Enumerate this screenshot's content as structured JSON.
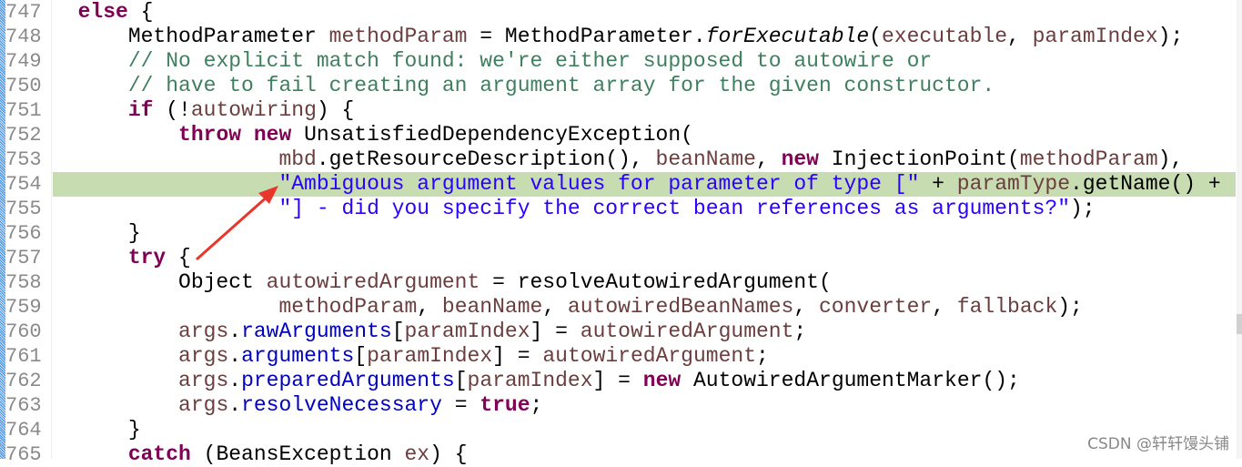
{
  "colors": {
    "keyword": "#7f0055",
    "comment": "#3f7f5f",
    "field": "#0000c0",
    "string": "#2a00ff",
    "local": "#6a3e3e",
    "highlight": "#c7ddb1",
    "arrow": "#e8362c"
  },
  "highlighted_line": "754",
  "lines": [
    {
      "n": "747",
      "t": [
        [
          "p",
          "  "
        ],
        [
          "kw",
          "else"
        ],
        [
          "p",
          " {"
        ]
      ]
    },
    {
      "n": "748",
      "t": [
        [
          "p",
          "      MethodParameter "
        ],
        [
          "lv",
          "methodParam"
        ],
        [
          "p",
          " = MethodParameter."
        ],
        [
          "it",
          "forExecutable"
        ],
        [
          "p",
          "("
        ],
        [
          "lv",
          "executable"
        ],
        [
          "p",
          ", "
        ],
        [
          "lv",
          "paramIndex"
        ],
        [
          "p",
          ");"
        ]
      ]
    },
    {
      "n": "749",
      "t": [
        [
          "p",
          "      "
        ],
        [
          "cm",
          "// No explicit match found: we're either supposed to autowire or"
        ]
      ]
    },
    {
      "n": "750",
      "t": [
        [
          "p",
          "      "
        ],
        [
          "cm",
          "// have to fail creating an argument array for the given constructor."
        ]
      ]
    },
    {
      "n": "751",
      "t": [
        [
          "p",
          "      "
        ],
        [
          "kw",
          "if"
        ],
        [
          "p",
          " (!"
        ],
        [
          "lv",
          "autowiring"
        ],
        [
          "p",
          ") {"
        ]
      ]
    },
    {
      "n": "752",
      "t": [
        [
          "p",
          "          "
        ],
        [
          "kw",
          "throw"
        ],
        [
          "p",
          " "
        ],
        [
          "kw",
          "new"
        ],
        [
          "p",
          " UnsatisfiedDependencyException("
        ]
      ]
    },
    {
      "n": "753",
      "t": [
        [
          "p",
          "                  "
        ],
        [
          "lv",
          "mbd"
        ],
        [
          "p",
          ".getResourceDescription(), "
        ],
        [
          "lv",
          "beanName"
        ],
        [
          "p",
          ", "
        ],
        [
          "kw",
          "new"
        ],
        [
          "p",
          " InjectionPoint("
        ],
        [
          "lv",
          "methodParam"
        ],
        [
          "p",
          "),"
        ]
      ]
    },
    {
      "n": "754",
      "t": [
        [
          "p",
          "                  "
        ],
        [
          "st",
          "\"Ambiguous argument values for parameter of type [\""
        ],
        [
          "p",
          " + "
        ],
        [
          "lv",
          "paramType"
        ],
        [
          "p",
          ".getName() +"
        ]
      ]
    },
    {
      "n": "755",
      "t": [
        [
          "p",
          "                  "
        ],
        [
          "st",
          "\"] - did you specify the correct bean references as arguments?\""
        ],
        [
          "p",
          ");"
        ]
      ]
    },
    {
      "n": "756",
      "t": [
        [
          "p",
          "      }"
        ]
      ]
    },
    {
      "n": "757",
      "t": [
        [
          "p",
          "      "
        ],
        [
          "kw",
          "try"
        ],
        [
          "p",
          " {"
        ]
      ]
    },
    {
      "n": "758",
      "t": [
        [
          "p",
          "          Object "
        ],
        [
          "lv",
          "autowiredArgument"
        ],
        [
          "p",
          " = resolveAutowiredArgument("
        ]
      ]
    },
    {
      "n": "759",
      "t": [
        [
          "p",
          "                  "
        ],
        [
          "lv",
          "methodParam"
        ],
        [
          "p",
          ", "
        ],
        [
          "lv",
          "beanName"
        ],
        [
          "p",
          ", "
        ],
        [
          "lv",
          "autowiredBeanNames"
        ],
        [
          "p",
          ", "
        ],
        [
          "lv",
          "converter"
        ],
        [
          "p",
          ", "
        ],
        [
          "lv",
          "fallback"
        ],
        [
          "p",
          ");"
        ]
      ]
    },
    {
      "n": "760",
      "t": [
        [
          "p",
          "          "
        ],
        [
          "lv",
          "args"
        ],
        [
          "p",
          "."
        ],
        [
          "fd",
          "rawArguments"
        ],
        [
          "p",
          "["
        ],
        [
          "lv",
          "paramIndex"
        ],
        [
          "p",
          "] = "
        ],
        [
          "lv",
          "autowiredArgument"
        ],
        [
          "p",
          ";"
        ]
      ]
    },
    {
      "n": "761",
      "t": [
        [
          "p",
          "          "
        ],
        [
          "lv",
          "args"
        ],
        [
          "p",
          "."
        ],
        [
          "fd",
          "arguments"
        ],
        [
          "p",
          "["
        ],
        [
          "lv",
          "paramIndex"
        ],
        [
          "p",
          "] = "
        ],
        [
          "lv",
          "autowiredArgument"
        ],
        [
          "p",
          ";"
        ]
      ]
    },
    {
      "n": "762",
      "t": [
        [
          "p",
          "          "
        ],
        [
          "lv",
          "args"
        ],
        [
          "p",
          "."
        ],
        [
          "fd",
          "preparedArguments"
        ],
        [
          "p",
          "["
        ],
        [
          "lv",
          "paramIndex"
        ],
        [
          "p",
          "] = "
        ],
        [
          "kw",
          "new"
        ],
        [
          "p",
          " AutowiredArgumentMarker();"
        ]
      ]
    },
    {
      "n": "763",
      "t": [
        [
          "p",
          "          "
        ],
        [
          "lv",
          "args"
        ],
        [
          "p",
          "."
        ],
        [
          "fd",
          "resolveNecessary"
        ],
        [
          "p",
          " = "
        ],
        [
          "kw",
          "true"
        ],
        [
          "p",
          ";"
        ]
      ]
    },
    {
      "n": "764",
      "t": [
        [
          "p",
          "      }"
        ]
      ]
    },
    {
      "n": "765",
      "t": [
        [
          "p",
          "      "
        ],
        [
          "kw",
          "catch"
        ],
        [
          "p",
          " (BeansException "
        ],
        [
          "lv",
          "ex"
        ],
        [
          "p",
          ") {"
        ]
      ]
    }
  ],
  "watermark": "CSDN @轩轩馒头铺"
}
